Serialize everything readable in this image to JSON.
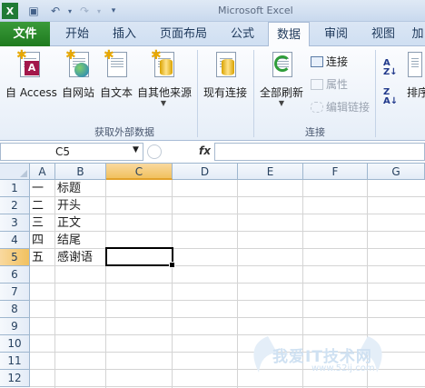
{
  "window": {
    "title": "Microsoft Excel"
  },
  "tabs": [
    {
      "label": "文件"
    },
    {
      "label": "开始"
    },
    {
      "label": "插入"
    },
    {
      "label": "页面布局"
    },
    {
      "label": "公式"
    },
    {
      "label": "数据"
    },
    {
      "label": "审阅"
    },
    {
      "label": "视图"
    },
    {
      "label": "加"
    }
  ],
  "active_tab": "数据",
  "ribbon": {
    "get_external": {
      "group_label": "获取外部数据",
      "buttons": [
        {
          "label": "自 Access"
        },
        {
          "label": "自网站"
        },
        {
          "label": "自文本"
        },
        {
          "label": "自其他来源"
        },
        {
          "label": "现有连接"
        }
      ]
    },
    "connections": {
      "group_label": "连接",
      "refresh_label": "全部刷新",
      "connections_label": "连接",
      "properties_label": "属性",
      "edit_links_label": "编辑链接"
    },
    "sort": {
      "sort_label": "排序"
    }
  },
  "formula_bar": {
    "name_box": "C5",
    "fx": "fx",
    "value": ""
  },
  "columns": [
    "A",
    "B",
    "C",
    "D",
    "E",
    "F",
    "G"
  ],
  "selected_column": "C",
  "rows": [
    "1",
    "2",
    "3",
    "4",
    "5",
    "6",
    "7",
    "8",
    "9",
    "10",
    "11",
    "12"
  ],
  "selected_row": "5",
  "cells": {
    "A1": "一",
    "B1": "标题",
    "A2": "二",
    "B2": "开头",
    "A3": "三",
    "B3": "正文",
    "A4": "四",
    "B4": "结尾",
    "A5": "五",
    "B5": "感谢语"
  },
  "watermark": {
    "text": "我爱IT技术网",
    "url": "www.52ij.com"
  }
}
